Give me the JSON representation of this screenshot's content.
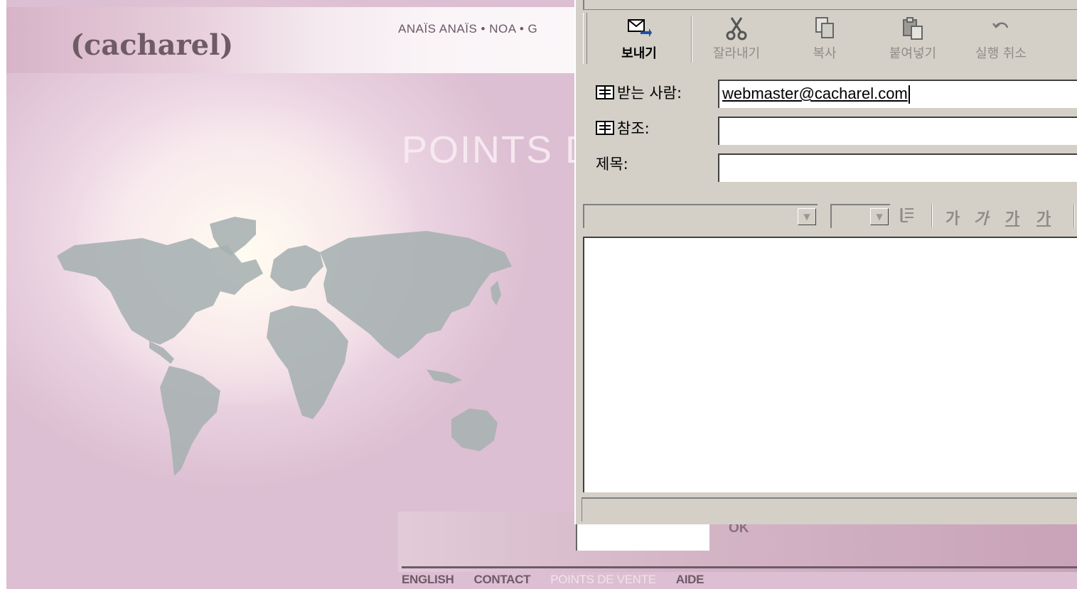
{
  "site": {
    "logo": "(cacharel)",
    "top_nav": "ANAÏS ANAÏS • NOA • G",
    "heading": "POINTS D",
    "ok_label": "OK",
    "footer_nav": [
      "ENGLISH",
      "CONTACT",
      "POINTS DE VENTE",
      "AIDE"
    ],
    "active_footer_item": "POINTS DE VENTE"
  },
  "compose": {
    "toolbar": [
      {
        "label": "보내기",
        "icon": "send-icon",
        "enabled": true
      },
      {
        "label": "잘라내기",
        "icon": "cut-icon",
        "enabled": false
      },
      {
        "label": "복사",
        "icon": "copy-icon",
        "enabled": false
      },
      {
        "label": "붙여넣기",
        "icon": "paste-icon",
        "enabled": false
      },
      {
        "label": "실행 취소",
        "icon": "undo-icon",
        "enabled": false
      }
    ],
    "to_label": "받는 사람:",
    "to_value": "webmaster@cacharel.com",
    "cc_label": "참조:",
    "cc_value": "",
    "subject_label": "제목:",
    "subject_value": "",
    "format": {
      "font_value": "",
      "size_value": "",
      "buttons": [
        "가",
        "가",
        "가",
        "가"
      ]
    },
    "body_text": ""
  },
  "colors": {
    "dialog_gray": "#d4d0c8",
    "site_pink": "#d7b4c8",
    "footer_text": "#6f5a68"
  }
}
